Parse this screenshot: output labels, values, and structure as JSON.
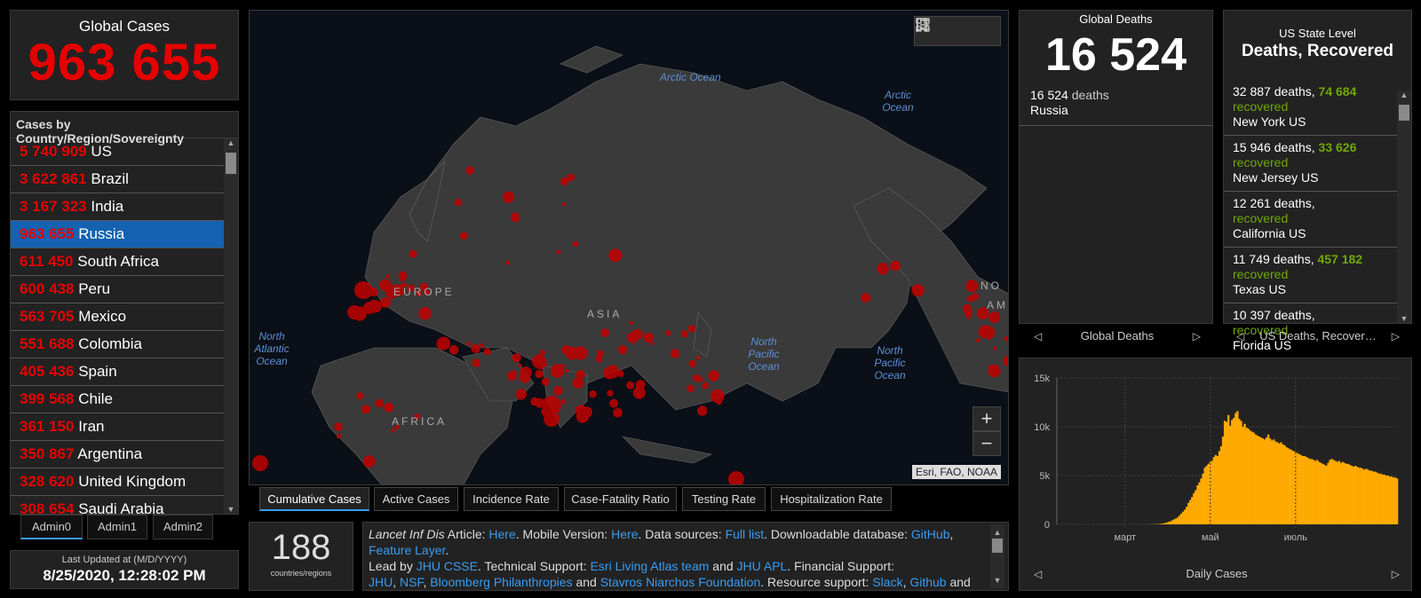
{
  "colors": {
    "accent_red": "#e60000",
    "recovered_green": "#70a800",
    "link_blue": "#3a9cf0",
    "chart_orange": "#ffaa00",
    "selected_blue": "#1462b0"
  },
  "global_cases": {
    "title": "Global Cases",
    "value": "963 655"
  },
  "country_list": {
    "header": "Cases by Country/Region/Sovereignty",
    "selected": "Russia",
    "rows": [
      {
        "value": "5 740 909",
        "name": "US"
      },
      {
        "value": "3 622 861",
        "name": "Brazil"
      },
      {
        "value": "3 167 323",
        "name": "India"
      },
      {
        "value": "963 655",
        "name": "Russia"
      },
      {
        "value": "611 450",
        "name": "South Africa"
      },
      {
        "value": "600 438",
        "name": "Peru"
      },
      {
        "value": "563 705",
        "name": "Mexico"
      },
      {
        "value": "551 688",
        "name": "Colombia"
      },
      {
        "value": "405 436",
        "name": "Spain"
      },
      {
        "value": "399 568",
        "name": "Chile"
      },
      {
        "value": "361 150",
        "name": "Iran"
      },
      {
        "value": "350 867",
        "name": "Argentina"
      },
      {
        "value": "328 620",
        "name": "United Kingdom"
      },
      {
        "value": "308 654",
        "name": "Saudi Arabia"
      }
    ]
  },
  "admin_tabs": [
    "Admin0",
    "Admin1",
    "Admin2"
  ],
  "last_updated": {
    "label": "Last Updated at (M/D/YYYY)",
    "value": "8/25/2020, 12:28:02 PM"
  },
  "map": {
    "attribution": "Esri, FAO, NOAA",
    "oceans": {
      "arctic1": "Arctic Ocean",
      "arctic2": "Arctic Ocean",
      "north_atlantic": "North Atlantic Ocean",
      "north_pacific1": "North Pacific Ocean",
      "north_pacific2": "North Pacific Ocean"
    },
    "continents": {
      "europe": "EUROPE",
      "asia": "ASIA",
      "africa": "AFRICA",
      "north_america": "NO",
      "america": "AM"
    },
    "zoom_in": "+",
    "zoom_out": "−",
    "tools": [
      "bookmark-icon",
      "list-icon",
      "qr-grid-icon"
    ]
  },
  "map_tabs": [
    "Cumulative Cases",
    "Active Cases",
    "Incidence Rate",
    "Case-Fatality Ratio",
    "Testing Rate",
    "Hospitalization Rate"
  ],
  "countries_count": {
    "value": "188",
    "label": "countries/regions"
  },
  "info": {
    "p1": "Lancet Inf Dis",
    "p2": " Article: ",
    "l1": "Here",
    "p3": ". Mobile Version: ",
    "l2": "Here",
    "p4": ". Data sources: ",
    "l3": "Full list",
    "p5": ". Downloadable database: ",
    "l4": "GitHub",
    "p6": ", ",
    "l5": "Feature Layer",
    "p7": ".",
    "p8": "Lead by ",
    "l6": "JHU CSSE",
    "p9": ". Technical Support: ",
    "l7": "Esri Living Atlas team",
    "p10": " and ",
    "l8": "JHU APL",
    "p11": ". Financial Support: ",
    "l9": "JHU",
    "p12": ", ",
    "l10": "NSF",
    "p13": ", ",
    "l11": "Bloomberg Philanthropies",
    "p14": " and ",
    "l12": "Stavros Niarchos Foundation",
    "p15": ". Resource support: ",
    "l13": "Slack",
    "p16": ", ",
    "l14": "Github",
    "p17": " and"
  },
  "global_deaths": {
    "title": "Global Deaths",
    "value": "16 524",
    "item_value": "16 524",
    "item_unit": " deaths",
    "item_place": "Russia",
    "pager_label": "Global Deaths"
  },
  "us_state": {
    "title1": "US State Level",
    "title2": "Deaths, Recovered",
    "pager_label": "US Deaths, Recover…",
    "deaths_word": " deaths, ",
    "recovered_word": "recovered",
    "rows": [
      {
        "deaths": "32 887",
        "recovered": "74 684",
        "place": "New York US"
      },
      {
        "deaths": "15 946",
        "recovered": "33 626",
        "place": "New Jersey US"
      },
      {
        "deaths": "12 261",
        "recovered": "",
        "place": "California US"
      },
      {
        "deaths": "11 749",
        "recovered": "457 182",
        "place": "Texas US"
      },
      {
        "deaths": "10 397",
        "recovered": "",
        "place": "Florida US"
      }
    ]
  },
  "daily_chart": {
    "pager_label": "Daily Cases"
  },
  "chart_data": {
    "type": "bar",
    "title": "Daily Cases",
    "xlabel": "",
    "ylabel": "",
    "ylim": [
      0,
      15000
    ],
    "yticks": [
      "0",
      "5k",
      "10k",
      "15k"
    ],
    "xticks": [
      "март",
      "май",
      "июль"
    ],
    "grid": true,
    "x_start": "2020-01-22",
    "series": [
      {
        "values": [
          0,
          0,
          0,
          0,
          0,
          0,
          0,
          0,
          0,
          0,
          0,
          0,
          0,
          0,
          0,
          0,
          0,
          0,
          0,
          0,
          0,
          0,
          0,
          0,
          0,
          0,
          0,
          0,
          0,
          0,
          0,
          0,
          0,
          0,
          0,
          0,
          0,
          0,
          0,
          0,
          0,
          0,
          0,
          0,
          0,
          0,
          2,
          2,
          3,
          5,
          8,
          10,
          12,
          18,
          25,
          35,
          45,
          60,
          90,
          130,
          180,
          250,
          300,
          400,
          500,
          600,
          700,
          900,
          1100,
          1300,
          1500,
          1800,
          2200,
          2500,
          2800,
          3200,
          3500,
          4000,
          4300,
          4700,
          5200,
          5800,
          6000,
          6200,
          6400,
          6500,
          6900,
          7100,
          7000,
          7500,
          8000,
          9000,
          10600,
          10500,
          11200,
          10100,
          10700,
          10900,
          11400,
          11600,
          10800,
          10600,
          10000,
          10300,
          9900,
          9800,
          9600,
          9500,
          9400,
          9200,
          9100,
          9000,
          8900,
          8800,
          8700,
          8900,
          9200,
          8800,
          8600,
          8700,
          8500,
          8400,
          8300,
          8400,
          8200,
          8100,
          7900,
          7800,
          7700,
          7600,
          7500,
          7400,
          7300,
          7200,
          7100,
          7000,
          7000,
          6900,
          6800,
          6700,
          6700,
          6600,
          6500,
          6600,
          6400,
          6300,
          6200,
          6100,
          6000,
          6300,
          6600,
          6700,
          6600,
          6500,
          6400,
          6500,
          6300,
          6400,
          6300,
          6200,
          6200,
          6100,
          6000,
          5900,
          6000,
          5900,
          5800,
          5800,
          5700,
          5600,
          5700,
          5600,
          5500,
          5500,
          5400,
          5400,
          5300,
          5200,
          5200,
          5100,
          5100,
          5000,
          5000,
          4900,
          4900,
          4800,
          4800,
          4700
        ]
      }
    ]
  }
}
